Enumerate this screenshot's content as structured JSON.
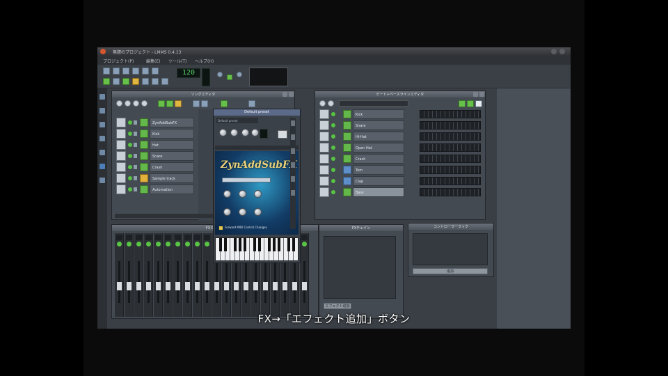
{
  "window": {
    "title": "無題のプロジェクト - LMMS 0.4.13"
  },
  "menu": [
    "プロジェクト(P)",
    "編集(E)",
    "ツール(T)",
    "ヘルプ(H)"
  ],
  "toolbar": {
    "tempo": "120"
  },
  "song_editor": {
    "title": "ソングエディタ",
    "tracks": [
      {
        "name": "ZynAddSubFX",
        "type": "instrument"
      },
      {
        "name": "Kick",
        "type": "instrument"
      },
      {
        "name": "Hat",
        "type": "instrument"
      },
      {
        "name": "Snare",
        "type": "instrument"
      },
      {
        "name": "Crash",
        "type": "instrument"
      },
      {
        "name": "Sample track",
        "type": "sample"
      },
      {
        "name": "Automation",
        "type": "instrument"
      }
    ]
  },
  "plugin": {
    "title": "Default preset",
    "preset": "Default preset",
    "logo": "ZynAddSubFX",
    "forward_midi_label": "Forward MIDI Control Changes"
  },
  "beat_editor": {
    "title": "ビート+ベースラインエディタ",
    "tracks": [
      "Kick",
      "Snare",
      "Hi-Hat",
      "Open Hat",
      "Crash",
      "Tom",
      "Clap",
      "Bass"
    ]
  },
  "fx_mixer": {
    "title": "FXミキサー",
    "channels": 20
  },
  "fx_chain": {
    "title": "FXチェイン",
    "add_label": "エフェクト追加"
  },
  "controller_rack": {
    "title": "コントローラーラック",
    "add_label": "追加"
  },
  "subtitle": "FX→「エフェクト追加」ボタン",
  "colors": {
    "accent_green": "#57c442",
    "folder_yellow": "#e2b13b",
    "panel": "#444a51"
  }
}
